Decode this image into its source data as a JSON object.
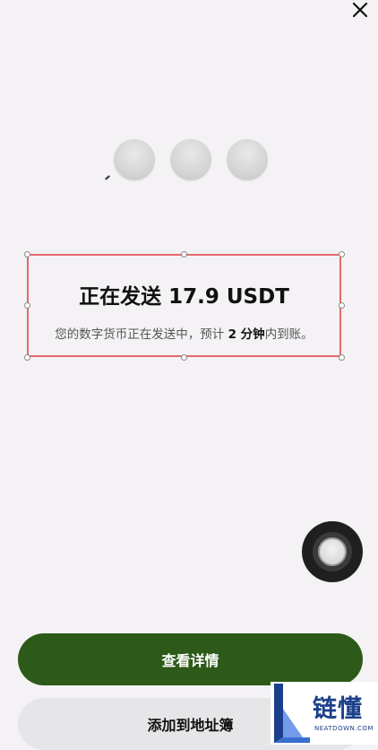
{
  "header": {
    "close_icon": "close-icon"
  },
  "status": {
    "title": "正在发送 17.9 USDT",
    "subtitle_prefix": "您的数字货币正在发送中，预计 ",
    "subtitle_bold": "2 分钟",
    "subtitle_suffix": "内到账。"
  },
  "actions": {
    "primary_label": "查看详情",
    "secondary_label": "添加到地址簿"
  },
  "watermark": {
    "text": "链懂",
    "sub": "NEATDOWN.COM"
  },
  "colors": {
    "background": "#f4f2f5",
    "primary_button": "#2d5a18",
    "secondary_button": "#e6e5e8",
    "selection_border": "#e36a6a",
    "watermark": "#1b3f8a"
  }
}
